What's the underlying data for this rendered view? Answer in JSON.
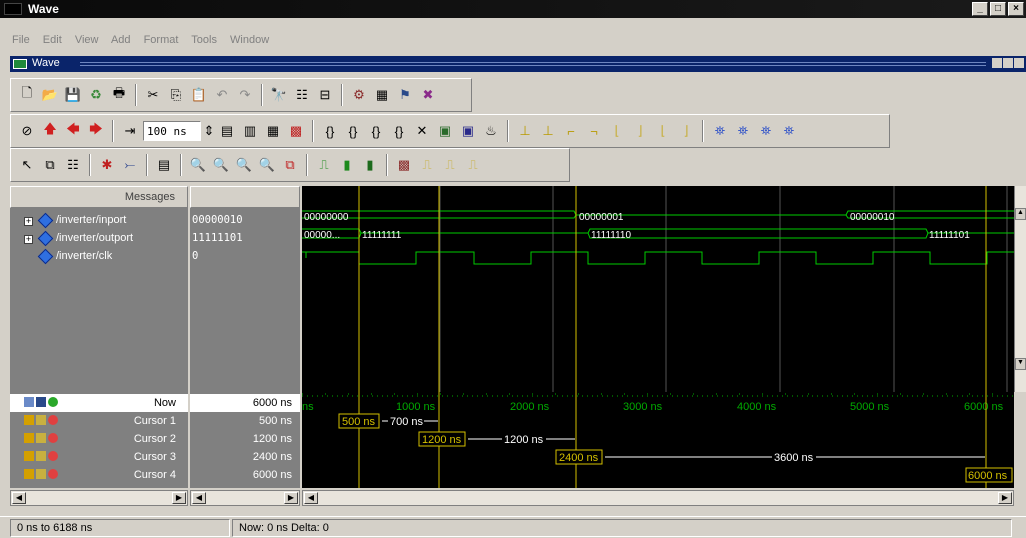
{
  "window": {
    "title": "Wave"
  },
  "menu": [
    "File",
    "Edit",
    "View",
    "Add",
    "Format",
    "Tools",
    "Window"
  ],
  "subwindow": {
    "title": "Wave"
  },
  "toolbar": {
    "zoom_step": "100 ns"
  },
  "headers": {
    "messages": "Messages"
  },
  "signals": [
    {
      "name": "/inverter/inport",
      "value": "00000010"
    },
    {
      "name": "/inverter/outport",
      "value": "11111101"
    },
    {
      "name": "/inverter/clk",
      "value": "0"
    }
  ],
  "waves": {
    "inport_labels": [
      "00000000",
      "00000001",
      "00000010"
    ],
    "outport_labels": [
      "00000...",
      "11111111",
      "11111110",
      "11111101"
    ]
  },
  "cursors": {
    "now": {
      "label": "Now",
      "value": "6000 ns"
    },
    "list": [
      {
        "label": "Cursor 1",
        "value": "500 ns",
        "delta": "700 ns"
      },
      {
        "label": "Cursor 2",
        "value": "1200 ns",
        "delta": "1200 ns"
      },
      {
        "label": "Cursor 3",
        "value": "2400 ns",
        "delta": "3600 ns"
      },
      {
        "label": "Cursor 4",
        "value": "6000 ns",
        "delta": ""
      }
    ]
  },
  "timeline": {
    "ticks": [
      "ns",
      "1000 ns",
      "2000 ns",
      "3000 ns",
      "4000 ns",
      "5000 ns",
      "6000 ns"
    ]
  },
  "status": {
    "range": "0 ns to 6188 ns",
    "now": "Now: 0 ns  Delta: 0"
  },
  "colors": {
    "wave": "#00cc00",
    "cursor": "#d4c000",
    "grid": "#555555"
  }
}
